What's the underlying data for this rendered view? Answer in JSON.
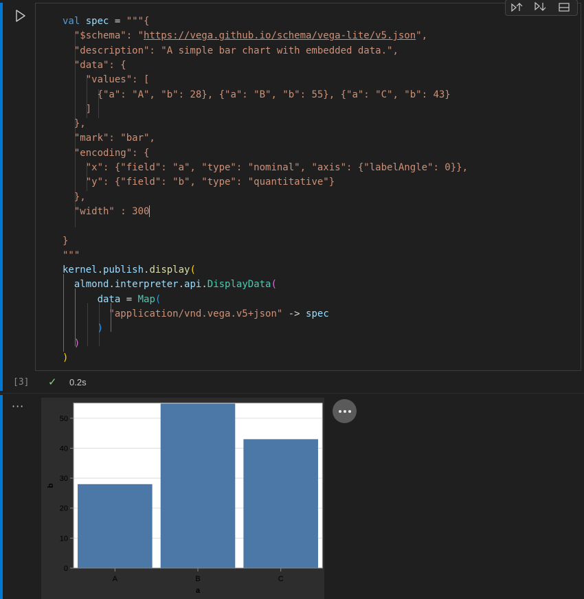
{
  "cell": {
    "execution_count": "[3]",
    "status_icon": "check-icon",
    "duration": "0.2s",
    "code_lines": [
      [
        [
          "kw",
          "val"
        ],
        [
          "t",
          " "
        ],
        [
          "var",
          "spec"
        ],
        [
          "t",
          " = "
        ],
        [
          "str",
          "\"\"\"{"
        ]
      ],
      [
        [
          "t",
          "  "
        ],
        [
          "str",
          "\"$schema\": \""
        ],
        [
          "url",
          "https://vega.github.io/schema/vega-lite/v5.json"
        ],
        [
          "str",
          "\","
        ]
      ],
      [
        [
          "t",
          "  "
        ],
        [
          "str",
          "\"description\": \"A simple bar chart with embedded data.\","
        ]
      ],
      [
        [
          "t",
          "  "
        ],
        [
          "str",
          "\"data\": {"
        ]
      ],
      [
        [
          "t",
          "    "
        ],
        [
          "str",
          "\"values\": ["
        ]
      ],
      [
        [
          "t",
          "      "
        ],
        [
          "str",
          "{\"a\": \"A\", \"b\": 28}, {\"a\": \"B\", \"b\": 55}, {\"a\": \"C\", \"b\": 43}"
        ]
      ],
      [
        [
          "t",
          "    "
        ],
        [
          "str",
          "]"
        ]
      ],
      [
        [
          "t",
          "  "
        ],
        [
          "str",
          "},"
        ]
      ],
      [
        [
          "t",
          "  "
        ],
        [
          "str",
          "\"mark\": \"bar\","
        ]
      ],
      [
        [
          "t",
          "  "
        ],
        [
          "str",
          "\"encoding\": {"
        ]
      ],
      [
        [
          "t",
          "    "
        ],
        [
          "str",
          "\"x\": {\"field\": \"a\", \"type\": \"nominal\", \"axis\": {\"labelAngle\": 0}},"
        ]
      ],
      [
        [
          "t",
          "    "
        ],
        [
          "str",
          "\"y\": {\"field\": \"b\", \"type\": \"quantitative\"}"
        ]
      ],
      [
        [
          "t",
          "  "
        ],
        [
          "str",
          "},"
        ]
      ],
      [
        [
          "t",
          "  "
        ],
        [
          "str",
          "\"width\" : 300"
        ]
      ],
      [],
      [
        [
          "str",
          "}"
        ]
      ],
      [
        [
          "str",
          "\"\"\""
        ]
      ],
      [
        [
          "var",
          "kernel"
        ],
        [
          "t",
          "."
        ],
        [
          "var",
          "publish"
        ],
        [
          "t",
          "."
        ],
        [
          "fn",
          "display"
        ],
        [
          "b1",
          "("
        ]
      ],
      [
        [
          "t",
          "  "
        ],
        [
          "var",
          "almond"
        ],
        [
          "t",
          "."
        ],
        [
          "var",
          "interpreter"
        ],
        [
          "t",
          "."
        ],
        [
          "var",
          "api"
        ],
        [
          "t",
          "."
        ],
        [
          "type",
          "DisplayData"
        ],
        [
          "b2",
          "("
        ]
      ],
      [
        [
          "t",
          "      "
        ],
        [
          "var",
          "data"
        ],
        [
          "t",
          " = "
        ],
        [
          "type",
          "Map"
        ],
        [
          "b3",
          "("
        ]
      ],
      [
        [
          "t",
          "        "
        ],
        [
          "str",
          "\"application/vnd.vega.v5+json\""
        ],
        [
          "t",
          " -> "
        ],
        [
          "var",
          "spec"
        ]
      ],
      [
        [
          "t",
          "      "
        ],
        [
          "b3",
          ")"
        ]
      ],
      [
        [
          "t",
          "  "
        ],
        [
          "b2",
          ")"
        ]
      ],
      [
        [
          "b1",
          ")"
        ]
      ]
    ]
  },
  "toolbar": {
    "icons": [
      "execute-above-icon",
      "execute-below-icon",
      "split-cell-icon"
    ]
  },
  "output": {
    "more_icon": "more-actions-icon"
  },
  "chart_data": {
    "type": "bar",
    "categories": [
      "A",
      "B",
      "C"
    ],
    "values": [
      28,
      55,
      43
    ],
    "xlabel": "a",
    "ylabel": "b",
    "yticks": [
      0,
      10,
      20,
      30,
      40,
      50
    ],
    "ylim": [
      0,
      55
    ],
    "grid": true,
    "bar_color": "#4c78a8"
  },
  "colors": {
    "cell_accent": "#0078d4",
    "background": "#1f1f1f",
    "success": "#89d185"
  }
}
